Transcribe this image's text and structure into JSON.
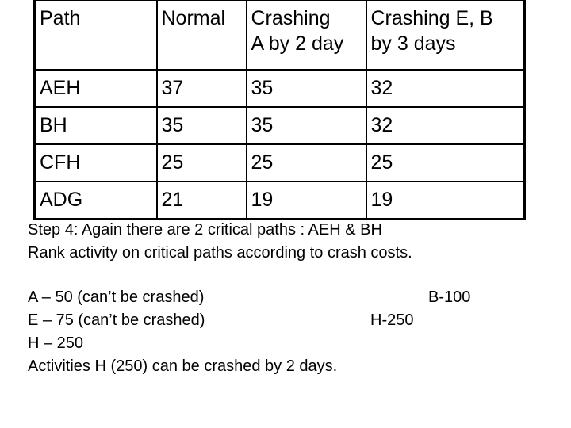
{
  "table": {
    "headers": [
      {
        "lines": [
          "Path"
        ]
      },
      {
        "lines": [
          "Normal"
        ]
      },
      {
        "lines": [
          "Crashing",
          "A by 2 day"
        ]
      },
      {
        "lines": [
          "Crashing E, B",
          "by 3 days"
        ]
      }
    ],
    "rows": [
      {
        "path": "AEH",
        "normal": "37",
        "crash_a": "35",
        "crash_eb": "32"
      },
      {
        "path": "BH",
        "normal": "35",
        "crash_a": "35",
        "crash_eb": "32"
      },
      {
        "path": "CFH",
        "normal": "25",
        "crash_a": "25",
        "crash_eb": "25"
      },
      {
        "path": "ADG",
        "normal": "21",
        "crash_a": "19",
        "crash_eb": "19"
      }
    ]
  },
  "step": {
    "line1": "Step 4: Again there are 2 critical paths : AEH & BH",
    "line2": "Rank activity on critical paths according to crash costs."
  },
  "ranking": {
    "left": [
      "A – 50  (can’t be crashed)",
      "E – 75  (can’t be crashed)",
      "H – 250"
    ],
    "right": [
      "B-100",
      "H-250"
    ],
    "conclusion": "Activities H (250) can be crashed by 2 days."
  }
}
